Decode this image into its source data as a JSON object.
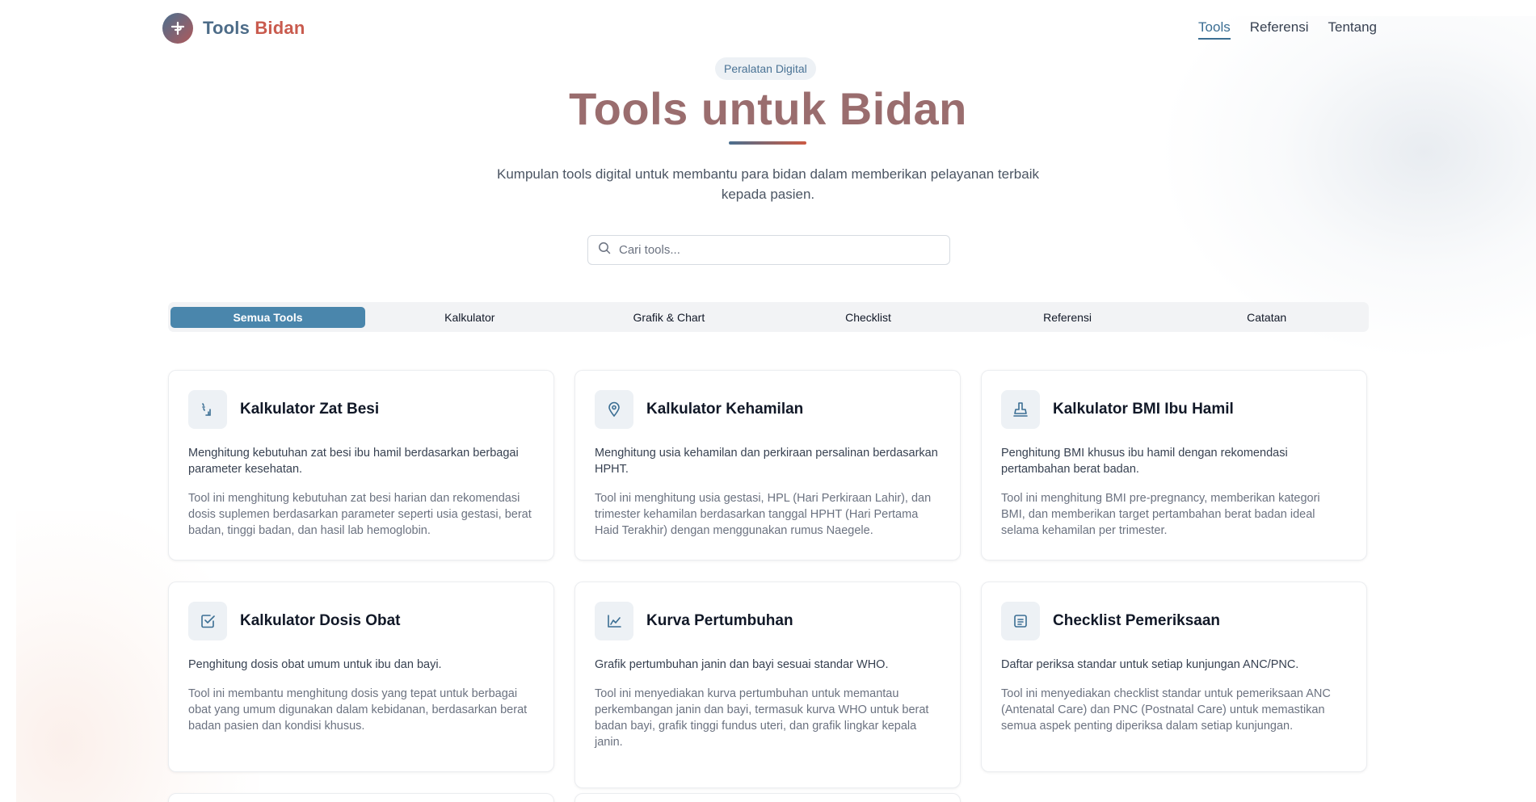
{
  "brand": {
    "part1": "Tools",
    "part2": "Bidan",
    "logo_icon": "stethoscope-logo-icon"
  },
  "nav": [
    {
      "label": "Tools",
      "active": true
    },
    {
      "label": "Referensi",
      "active": false
    },
    {
      "label": "Tentang",
      "active": false
    }
  ],
  "hero": {
    "badge": "Peralatan Digital",
    "title": "Tools untuk Bidan",
    "subtitle": "Kumpulan tools digital untuk membantu para bidan dalam memberikan pelayanan terbaik kepada pasien."
  },
  "search": {
    "placeholder": "Cari tools...",
    "value": "",
    "icon": "search-icon"
  },
  "tabs": [
    {
      "label": "Semua Tools",
      "active": true
    },
    {
      "label": "Kalkulator",
      "active": false
    },
    {
      "label": "Grafik & Chart",
      "active": false
    },
    {
      "label": "Checklist",
      "active": false
    },
    {
      "label": "Referensi",
      "active": false
    },
    {
      "label": "Catatan",
      "active": false
    }
  ],
  "cards": [
    {
      "icon": "pill-bottle-icon",
      "title": "Kalkulator Zat Besi",
      "desc": "Menghitung kebutuhan zat besi ibu hamil berdasarkan berbagai parameter kesehatan.",
      "detail": "Tool ini menghitung kebutuhan zat besi harian dan rekomendasi dosis suplemen berdasarkan parameter seperti usia gestasi, berat badan, tinggi badan, dan hasil lab hemoglobin."
    },
    {
      "icon": "map-pin-icon",
      "title": "Kalkulator Kehamilan",
      "desc": "Menghitung usia kehamilan dan perkiraan persalinan berdasarkan HPHT.",
      "detail": "Tool ini menghitung usia gestasi, HPL (Hari Perkiraan Lahir), dan trimester kehamilan berdasarkan tanggal HPHT (Hari Pertama Haid Terakhir) dengan menggunakan rumus Naegele."
    },
    {
      "icon": "scale-icon",
      "title": "Kalkulator BMI Ibu Hamil",
      "desc": "Penghitung BMI khusus ibu hamil dengan rekomendasi pertambahan berat badan.",
      "detail": "Tool ini menghitung BMI pre-pregnancy, memberikan kategori BMI, dan memberikan target pertambahan berat badan ideal selama kehamilan per trimester."
    },
    {
      "icon": "check-square-icon",
      "title": "Kalkulator Dosis Obat",
      "desc": "Penghitung dosis obat umum untuk ibu dan bayi.",
      "detail": "Tool ini membantu menghitung dosis yang tepat untuk berbagai obat yang umum digunakan dalam kebidanan, berdasarkan berat badan pasien dan kondisi khusus."
    },
    {
      "icon": "line-chart-icon",
      "title": "Kurva Pertumbuhan",
      "desc": "Grafik pertumbuhan janin dan bayi sesuai standar WHO.",
      "detail": "Tool ini menyediakan kurva pertumbuhan untuk memantau perkembangan janin dan bayi, termasuk kurva WHO untuk berat badan bayi, grafik tinggi fundus uteri, dan grafik lingkar kepala janin."
    },
    {
      "icon": "list-icon",
      "title": "Checklist Pemeriksaan",
      "desc": "Daftar periksa standar untuk setiap kunjungan ANC/PNC.",
      "detail": "Tool ini menyediakan checklist standar untuk pemeriksaan ANC (Antenatal Care) dan PNC (Postnatal Care) untuk memastikan semua aspek penting diperiksa dalam setiap kunjungan."
    }
  ],
  "colors": {
    "primary": "#4a86ac",
    "brand_blue": "#4d6c88",
    "brand_red": "#c95b4e",
    "title": "#9a6d6e"
  }
}
